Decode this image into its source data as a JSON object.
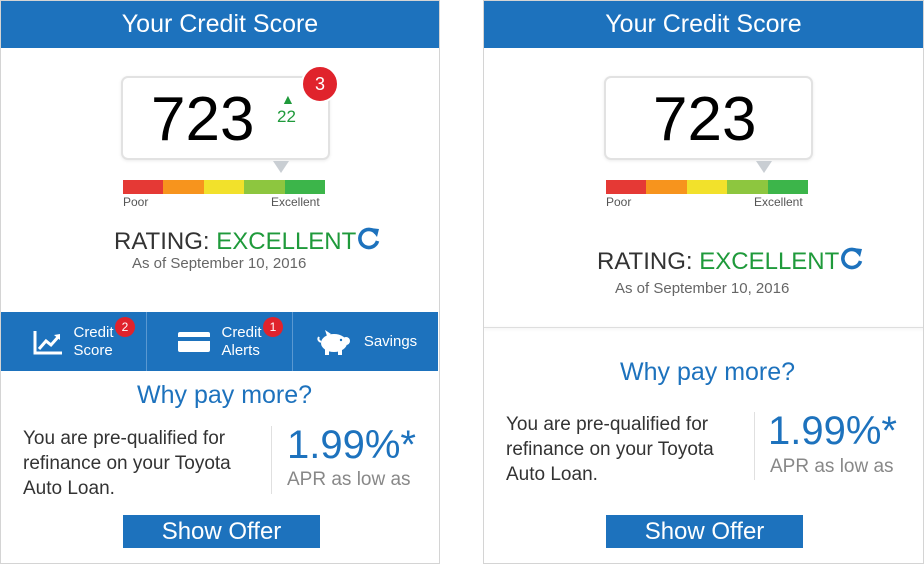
{
  "left_card": {
    "title": "Your Credit Score",
    "score": "723",
    "change_value": "22",
    "change_arrow": "▲",
    "notification_count": "3",
    "scale_low_label": "Poor",
    "scale_high_label": "Excellent",
    "rating_label": "RATING:",
    "rating_value": "EXCELLENT",
    "as_of": "As of September 10, 2016",
    "tabs": [
      {
        "line1": "Credit",
        "line2": "Score",
        "badge": "2",
        "icon": "trend-chart-icon"
      },
      {
        "line1": "Credit",
        "line2": "Alerts",
        "badge": "1",
        "icon": "credit-card-icon"
      },
      {
        "line1": "Savings",
        "line2": "",
        "badge": "",
        "icon": "piggy-bank-icon"
      }
    ],
    "why_title": "Why pay more?",
    "prequal_text": "You are pre-qualified for refinance on your Toyota Auto Loan.",
    "rate": "1.99%*",
    "apr_text": "APR as low as",
    "offer_button": "Show Offer"
  },
  "right_card": {
    "title": "Your Credit Score",
    "score": "723",
    "scale_low_label": "Poor",
    "scale_high_label": "Excellent",
    "rating_label": "RATING:",
    "rating_value": "EXCELLENT",
    "as_of": "As of September 10, 2016",
    "why_title": "Why pay more?",
    "prequal_text": "You are pre-qualified for refinance on your Toyota Auto Loan.",
    "rate": "1.99%*",
    "apr_text": "APR as low as",
    "offer_button": "Show Offer"
  },
  "colors": {
    "brand_blue": "#1d72bd",
    "rating_green": "#1f9a3b",
    "badge_red": "#e0232c",
    "scale": [
      "#e53935",
      "#f7941d",
      "#f2e12b",
      "#8dc63f",
      "#3cb54a"
    ]
  }
}
